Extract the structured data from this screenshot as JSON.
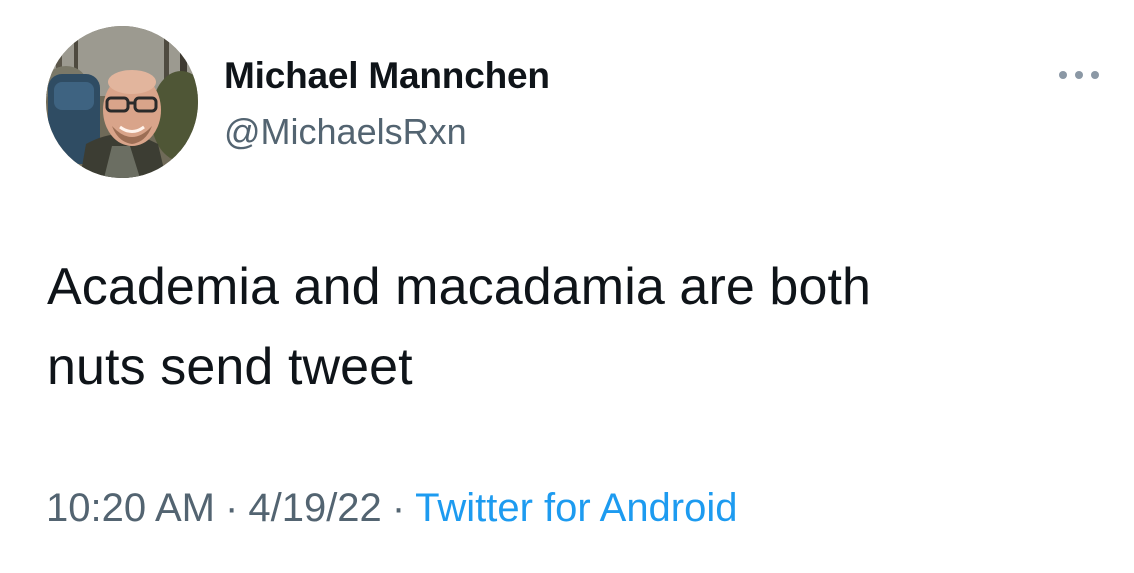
{
  "tweet": {
    "author": {
      "display_name": "Michael Mannchen",
      "handle": "@MichaelsRxn"
    },
    "text_lines": [
      "Academia and macadamia are both",
      "nuts send tweet"
    ],
    "time": "10:20 AM",
    "date": "4/19/22",
    "separator": "·",
    "source": "Twitter for Android",
    "more_icon": "ellipsis-icon"
  },
  "colors": {
    "primary_text": "#0f1419",
    "secondary_text": "#536471",
    "link": "#1d9bf0",
    "icon_gray": "#8b98a5"
  }
}
